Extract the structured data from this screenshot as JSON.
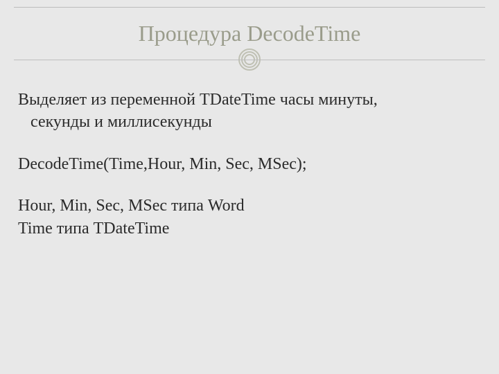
{
  "title": "Процедура DecodeTime",
  "body": {
    "p1_line1": "Выделяет из переменной TDateTime часы минуты,",
    "p1_line2": "секунды и миллисекунды",
    "p2": "DecodeTime(Time,Hour, Min, Sec, MSec);",
    "p3_line1": "Hour, Min, Sec, MSec типа Word",
    "p3_line2": "Time типа TDateTime"
  }
}
